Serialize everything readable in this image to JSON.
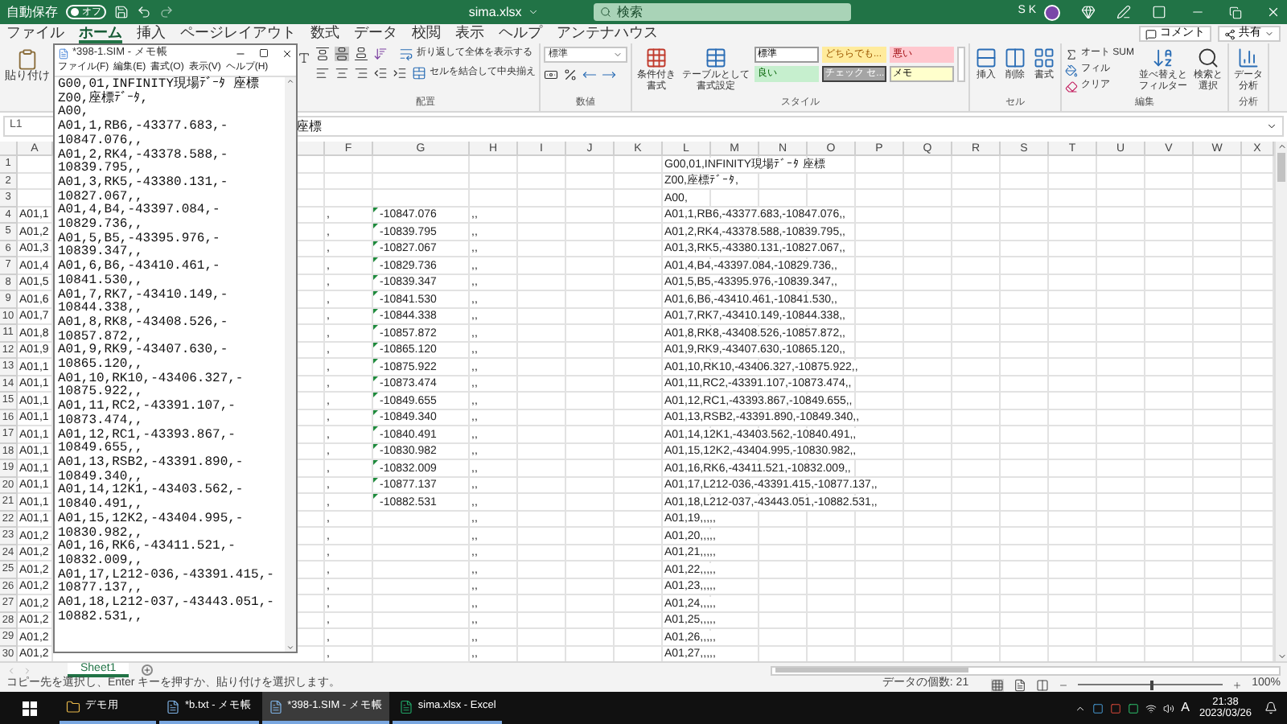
{
  "title_bar": {
    "autosave_label": "自動保存",
    "autosave_state": "オフ",
    "autosave_on": false,
    "file_title": "sima.xlsx",
    "search_placeholder": "検索",
    "user_name": "S K"
  },
  "ribbon_tabs": [
    {
      "label": "ファイル",
      "selected": false
    },
    {
      "label": "ホーム",
      "selected": true
    },
    {
      "label": "挿入",
      "selected": false
    },
    {
      "label": "ページレイアウト",
      "selected": false
    },
    {
      "label": "数式",
      "selected": false
    },
    {
      "label": "データ",
      "selected": false
    },
    {
      "label": "校閲",
      "selected": false
    },
    {
      "label": "表示",
      "selected": false
    },
    {
      "label": "ヘルプ",
      "selected": false
    },
    {
      "label": "アンテナハウス",
      "selected": false
    }
  ],
  "ribbon_actions": [
    "コメント",
    "共有"
  ],
  "ribbon": {
    "paste": "貼り付け",
    "alignment": {
      "label": "配置",
      "wrap_text": "折り返して全体を表示する",
      "merge_center": "セルを結合して中央揃え"
    },
    "number": {
      "label": "数値",
      "format": "標準"
    },
    "styles": {
      "label": "スタイル",
      "conditional": [
        "条件付き",
        "書式"
      ],
      "table": [
        "テーブルとして",
        "書式設定"
      ],
      "cells": [
        {
          "label": "標準",
          "kind": "normal"
        },
        {
          "label": "どちらでも...",
          "kind": "neutral"
        },
        {
          "label": "悪い",
          "kind": "bad"
        },
        {
          "label": "良い",
          "kind": "good"
        },
        {
          "label": "チェック セ...",
          "kind": "check"
        },
        {
          "label": "メモ",
          "kind": "note"
        }
      ]
    },
    "cells": {
      "label": "セル",
      "buttons": [
        "挿入",
        "削除",
        "書式"
      ]
    },
    "editing": {
      "label": "編集",
      "autosum": "オート SUM",
      "fill": "フィル",
      "clear": "クリア",
      "sort": [
        "並べ替えと",
        "フィルター"
      ],
      "find": [
        "検索と",
        "選択"
      ]
    },
    "analysis": {
      "label": "分析",
      "button": [
        "データ",
        "分析"
      ]
    }
  },
  "formula_bar": {
    "name_box": "L1",
    "formula": "座標"
  },
  "columns": [
    "A",
    "F",
    "G",
    "H",
    "I",
    "J",
    "K",
    "L",
    "M",
    "N",
    "O",
    "P",
    "Q",
    "R",
    "S",
    "T",
    "U",
    "V",
    "W",
    "X"
  ],
  "rows": [
    {
      "row": "1",
      "g_warning": false,
      "l": "G00,01,INFINITY現場ﾃﾞｰﾀ 座標"
    },
    {
      "row": "2",
      "g_warning": false,
      "l": "Z00,座標ﾃﾞｰﾀ,"
    },
    {
      "row": "3",
      "g_warning": false,
      "l": "A00,"
    },
    {
      "row": "4",
      "a": "A01,1",
      "f": ",",
      "g": "-10847.076",
      "g_warning": true,
      "h": ",,",
      "l": "A01,1,RB6,-43377.683,-10847.076,,"
    },
    {
      "row": "5",
      "a": "A01,2",
      "f": ",",
      "g": "-10839.795",
      "g_warning": true,
      "h": ",,",
      "l": "A01,2,RK4,-43378.588,-10839.795,,"
    },
    {
      "row": "6",
      "a": "A01,3",
      "f": ",",
      "g": "-10827.067",
      "g_warning": true,
      "h": ",,",
      "l": "A01,3,RK5,-43380.131,-10827.067,,"
    },
    {
      "row": "7",
      "a": "A01,4",
      "f": ",",
      "g": "-10829.736",
      "g_warning": true,
      "h": ",,",
      "l": "A01,4,B4,-43397.084,-10829.736,,"
    },
    {
      "row": "8",
      "a": "A01,5",
      "f": ",",
      "g": "-10839.347",
      "g_warning": true,
      "h": ",,",
      "l": "A01,5,B5,-43395.976,-10839.347,,"
    },
    {
      "row": "9",
      "a": "A01,6",
      "f": ",",
      "g": "-10841.530",
      "g_warning": true,
      "h": ",,",
      "l": "A01,6,B6,-43410.461,-10841.530,,"
    },
    {
      "row": "10",
      "a": "A01,7",
      "f": ",",
      "g": "-10844.338",
      "g_warning": true,
      "h": ",,",
      "l": "A01,7,RK7,-43410.149,-10844.338,,"
    },
    {
      "row": "11",
      "a": "A01,8",
      "f": ",",
      "g": "-10857.872",
      "g_warning": true,
      "h": ",,",
      "l": "A01,8,RK8,-43408.526,-10857.872,,"
    },
    {
      "row": "12",
      "a": "A01,9",
      "f": ",",
      "g": "-10865.120",
      "g_warning": true,
      "h": ",,",
      "l": "A01,9,RK9,-43407.630,-10865.120,,"
    },
    {
      "row": "13",
      "a": "A01,1",
      "f": ",",
      "g": "-10875.922",
      "g_warning": true,
      "h": ",,",
      "l": "A01,10,RK10,-43406.327,-10875.922,,"
    },
    {
      "row": "14",
      "a": "A01,1",
      "f": ",",
      "g": "-10873.474",
      "g_warning": true,
      "h": ",,",
      "l": "A01,11,RC2,-43391.107,-10873.474,,"
    },
    {
      "row": "15",
      "a": "A01,1",
      "f": ",",
      "g": "-10849.655",
      "g_warning": true,
      "h": ",,",
      "l": "A01,12,RC1,-43393.867,-10849.655,,"
    },
    {
      "row": "16",
      "a": "A01,1",
      "f": ",",
      "g": "-10849.340",
      "g_warning": true,
      "h": ",,",
      "l": "A01,13,RSB2,-43391.890,-10849.340,,"
    },
    {
      "row": "17",
      "a": "A01,1",
      "f": ",",
      "g": "-10840.491",
      "g_warning": true,
      "h": ",,",
      "l": "A01,14,12K1,-43403.562,-10840.491,,"
    },
    {
      "row": "18",
      "a": "A01,1",
      "f": ",",
      "g": "-10830.982",
      "g_warning": true,
      "h": ",,",
      "l": "A01,15,12K2,-43404.995,-10830.982,,"
    },
    {
      "row": "19",
      "a": "A01,1",
      "f": ",",
      "g": "-10832.009",
      "g_warning": true,
      "h": ",,",
      "l": "A01,16,RK6,-43411.521,-10832.009,,"
    },
    {
      "row": "20",
      "a": "A01,1",
      "f": ",",
      "g": "-10877.137",
      "g_warning": true,
      "h": ",,",
      "l": "A01,17,L212-036,-43391.415,-10877.137,,"
    },
    {
      "row": "21",
      "a": "A01,1",
      "f": ",",
      "g": "-10882.531",
      "g_warning": true,
      "h": ",,",
      "l": "A01,18,L212-037,-43443.051,-10882.531,,"
    },
    {
      "row": "22",
      "a": "A01,1",
      "f": ",",
      "g_warning": false,
      "h": ",,",
      "l": "A01,19,,,,,"
    },
    {
      "row": "23",
      "a": "A01,2",
      "f": ",",
      "g_warning": false,
      "h": ",,",
      "l": "A01,20,,,,,"
    },
    {
      "row": "24",
      "a": "A01,2",
      "f": ",",
      "g_warning": false,
      "h": ",,",
      "l": "A01,21,,,,,"
    },
    {
      "row": "25",
      "a": "A01,2",
      "f": ",",
      "g_warning": false,
      "h": ",,",
      "l": "A01,22,,,,,"
    },
    {
      "row": "26",
      "a": "A01,2",
      "f": ",",
      "g_warning": false,
      "h": ",,",
      "l": "A01,23,,,,,"
    },
    {
      "row": "27",
      "a": "A01,2",
      "f": ",",
      "g_warning": false,
      "h": ",,",
      "l": "A01,24,,,,,"
    },
    {
      "row": "28",
      "a": "A01,2",
      "f": ",",
      "g_warning": false,
      "h": ",,",
      "l": "A01,25,,,,,"
    },
    {
      "row": "29",
      "a": "A01,2",
      "f": ",",
      "g_warning": false,
      "h": ",,",
      "l": "A01,26,,,,,"
    },
    {
      "row": "30",
      "a": "A01,2",
      "f": ",",
      "g_warning": false,
      "h": ",,",
      "l": "A01,27,,,,,"
    }
  ],
  "sheet_tabs": [
    {
      "label": "Sheet1",
      "selected": true
    }
  ],
  "status_bar": {
    "message": "コピー先を選択し、Enter キーを押すか、貼り付けを選択します。",
    "count": "データの個数: 21",
    "zoom": "100%",
    "zoom_slider": {
      "level": 0.5
    }
  },
  "notepad": {
    "title": "*398-1.SIM - メモ帳",
    "menu": [
      "ファイル(F)",
      "編集(E)",
      "書式(O)",
      "表示(V)",
      "ヘルプ(H)"
    ],
    "lines": [
      "G00,01,INFINITY現場ﾃﾞｰﾀ 座標",
      "Z00,座標ﾃﾞｰﾀ,",
      "A00,",
      "A01,1,RB6,-43377.683,-",
      "10847.076,,",
      "A01,2,RK4,-43378.588,-",
      "10839.795,,",
      "A01,3,RK5,-43380.131,-",
      "10827.067,,",
      "A01,4,B4,-43397.084,-",
      "10829.736,,",
      "A01,5,B5,-43395.976,-",
      "10839.347,,",
      "A01,6,B6,-43410.461,-",
      "10841.530,,",
      "A01,7,RK7,-43410.149,-",
      "10844.338,,",
      "A01,8,RK8,-43408.526,-",
      "10857.872,,",
      "A01,9,RK9,-43407.630,-",
      "10865.120,,",
      "A01,10,RK10,-43406.327,-",
      "10875.922,,",
      "A01,11,RC2,-43391.107,-",
      "10873.474,,",
      "A01,12,RC1,-43393.867,-",
      "10849.655,,",
      "A01,13,RSB2,-43391.890,-",
      "10849.340,,",
      "A01,14,12K1,-43403.562,-",
      "10840.491,,",
      "A01,15,12K2,-43404.995,-",
      "10830.982,,",
      "A01,16,RK6,-43411.521,-",
      "10832.009,,",
      "A01,17,L212-036,-43391.415,-",
      "10877.137,,",
      "A01,18,L212-037,-43443.051,-",
      "10882.531,,"
    ]
  },
  "taskbar": {
    "items": [
      {
        "label": "デモ用",
        "kind": "folder",
        "selected": false
      },
      {
        "label": "*b.txt - メモ帳",
        "kind": "notepad",
        "selected": false
      },
      {
        "label": "*398-1.SIM - メモ帳",
        "kind": "notepad",
        "selected": true
      },
      {
        "label": "sima.xlsx - Excel",
        "kind": "excel",
        "selected": false
      }
    ],
    "ime": "A",
    "time": "21:38",
    "date": "2023/03/26"
  }
}
